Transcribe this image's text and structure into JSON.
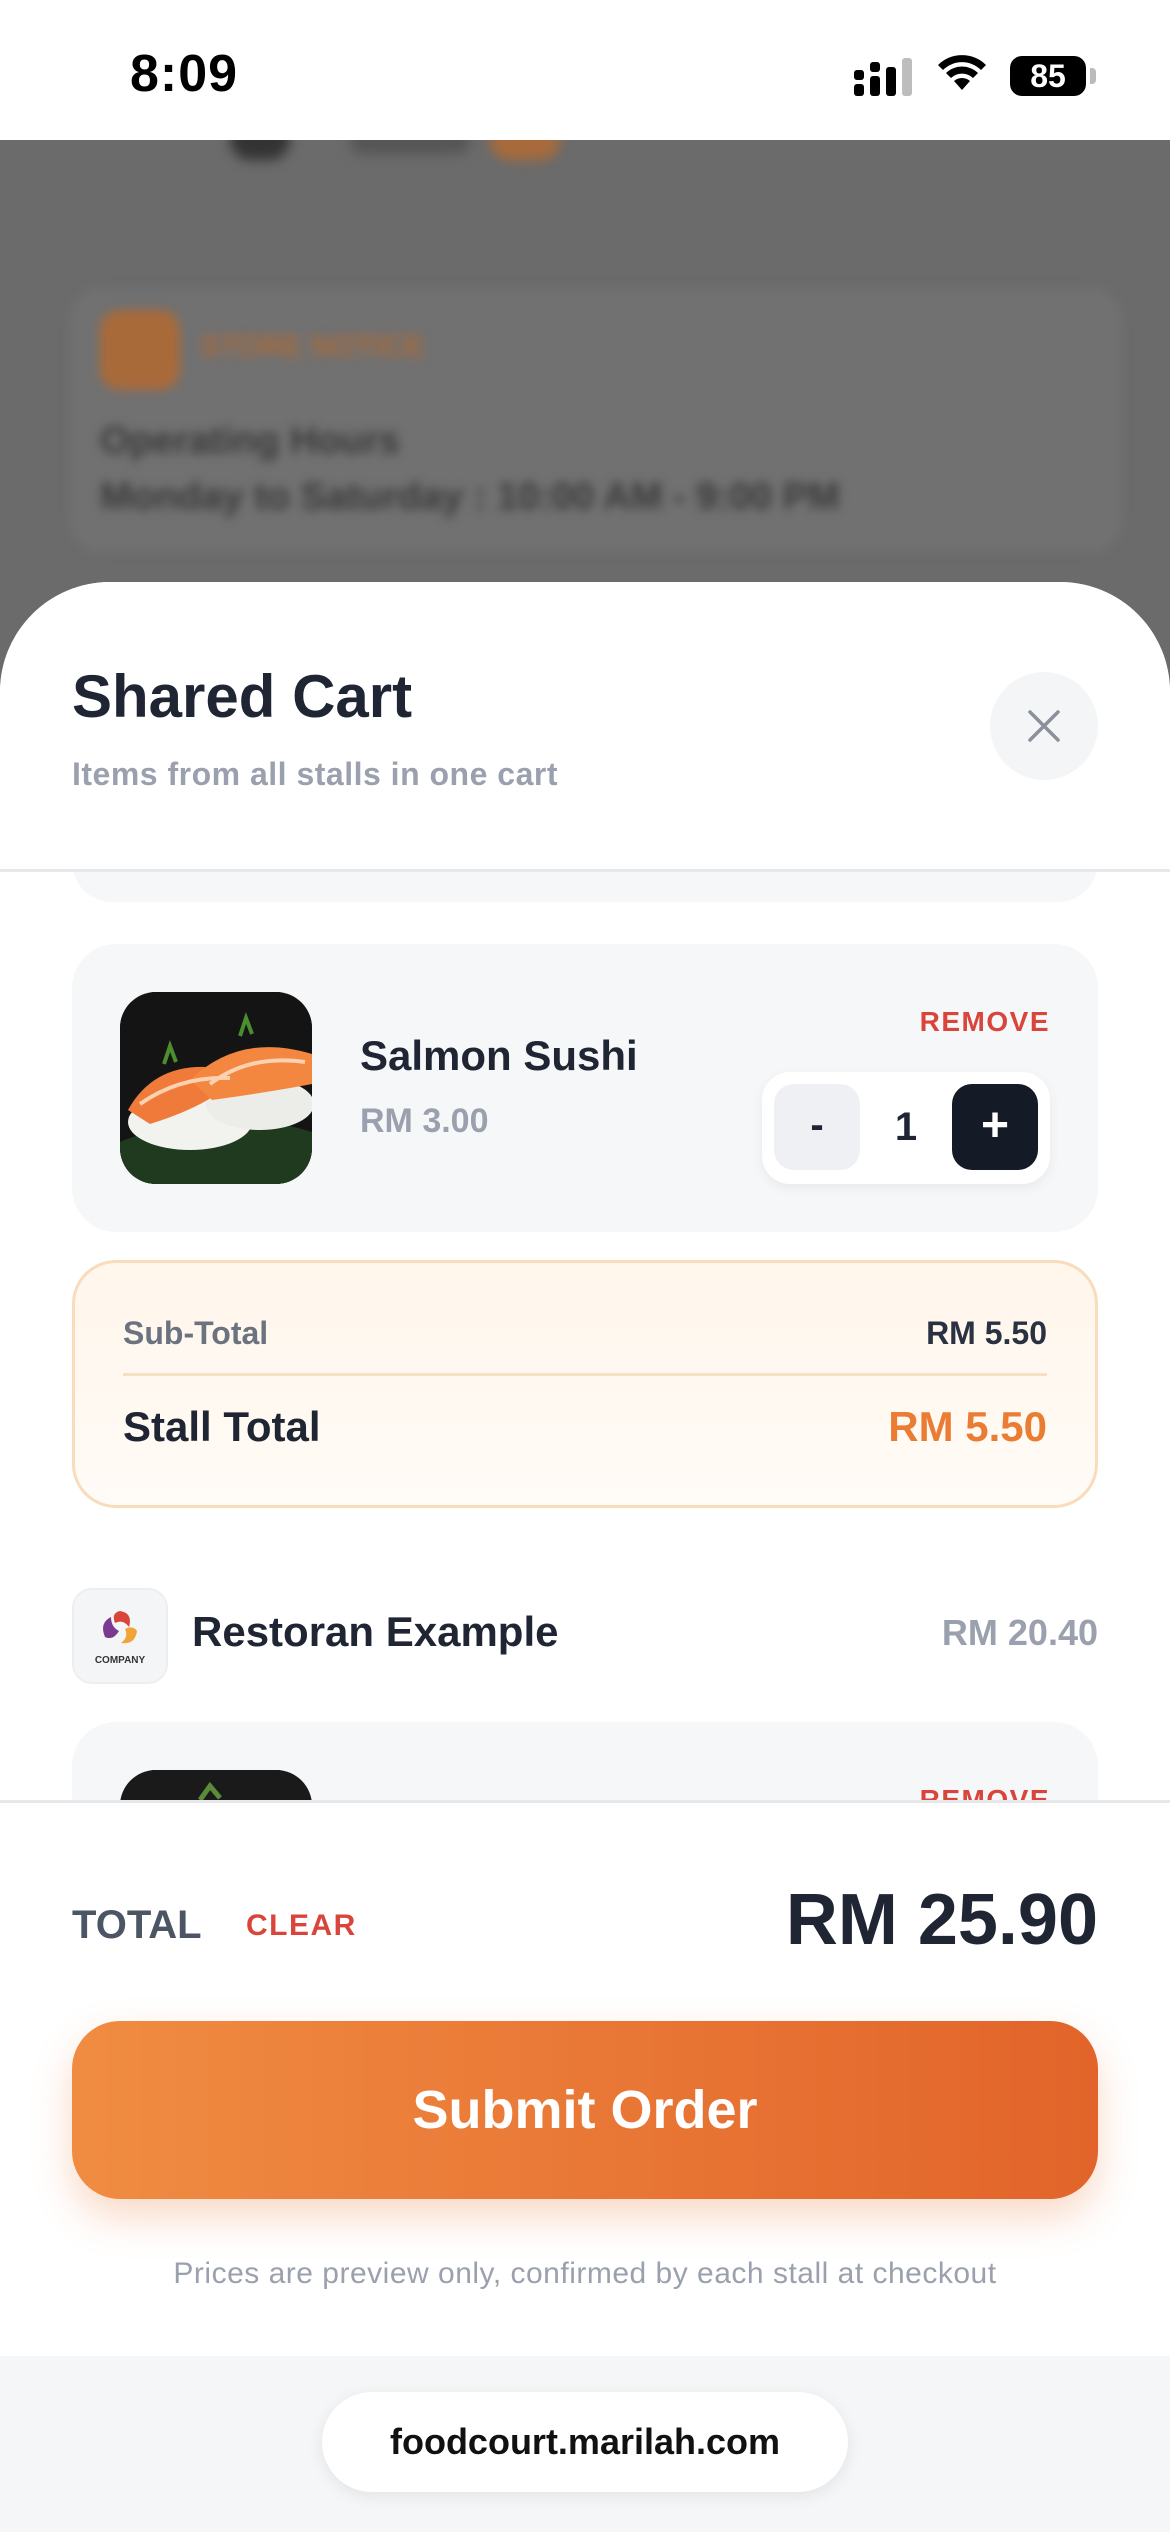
{
  "status_bar": {
    "time": "8:09",
    "battery": "85"
  },
  "background": {
    "notice_label": "STORE NOTICE",
    "hours_title": "Operating Hours",
    "hours_text": "Monday to Saturday : 10:00 AM - 9:00 PM"
  },
  "sheet": {
    "title": "Shared Cart",
    "subtitle": "Items from all stalls in one cart"
  },
  "items": [
    {
      "name": "Salmon Sushi",
      "price": "RM 3.00",
      "remove_label": "REMOVE",
      "quantity": "1",
      "minus_label": "-",
      "plus_label": "+"
    },
    {
      "remove_label": "REMOVE"
    }
  ],
  "stall_summary": {
    "subtotal_label": "Sub-Total",
    "subtotal_value": "RM 5.50",
    "total_label": "Stall Total",
    "total_value": "RM 5.50"
  },
  "next_stall": {
    "name": "Restoran Example",
    "amount": "RM 20.40",
    "logo_text": "COMPANY"
  },
  "footer": {
    "total_label": "TOTAL",
    "clear_label": "CLEAR",
    "total_value": "RM 25.90",
    "submit_label": "Submit Order",
    "note": "Prices are preview only, confirmed by each stall at checkout"
  },
  "browser": {
    "url": "foodcourt.marilah.com"
  },
  "colors": {
    "accent": "#ea7d33",
    "danger": "#d9453a",
    "dark": "#1f2533",
    "muted": "#9aa0ad"
  }
}
